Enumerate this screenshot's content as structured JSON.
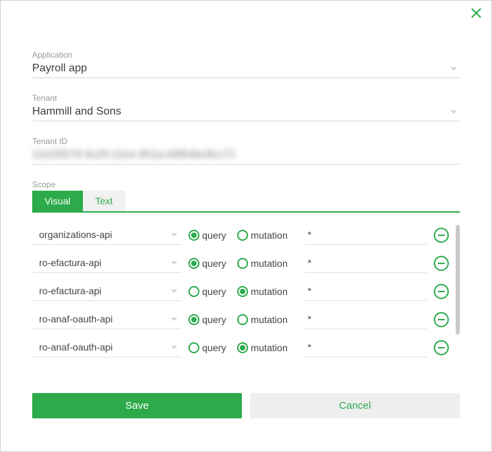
{
  "labels": {
    "application": "Application",
    "tenant": "Tenant",
    "tenantId": "Tenant ID",
    "scope": "Scope"
  },
  "fields": {
    "application": "Payroll app",
    "tenant": "Hammill and Sons",
    "tenantId": "12e33579-3c29-11ee-951a-b9fb4bc8cc71"
  },
  "tabs": {
    "visual": "Visual",
    "text": "Text"
  },
  "radioLabels": {
    "query": "query",
    "mutation": "mutation"
  },
  "scopeRows": [
    {
      "api": "organizations-api",
      "selected": "query",
      "pattern": "*"
    },
    {
      "api": "ro-efactura-api",
      "selected": "query",
      "pattern": "*"
    },
    {
      "api": "ro-efactura-api",
      "selected": "mutation",
      "pattern": "*"
    },
    {
      "api": "ro-anaf-oauth-api",
      "selected": "query",
      "pattern": "*"
    },
    {
      "api": "ro-anaf-oauth-api",
      "selected": "mutation",
      "pattern": "*"
    }
  ],
  "buttons": {
    "save": "Save",
    "cancel": "Cancel"
  }
}
